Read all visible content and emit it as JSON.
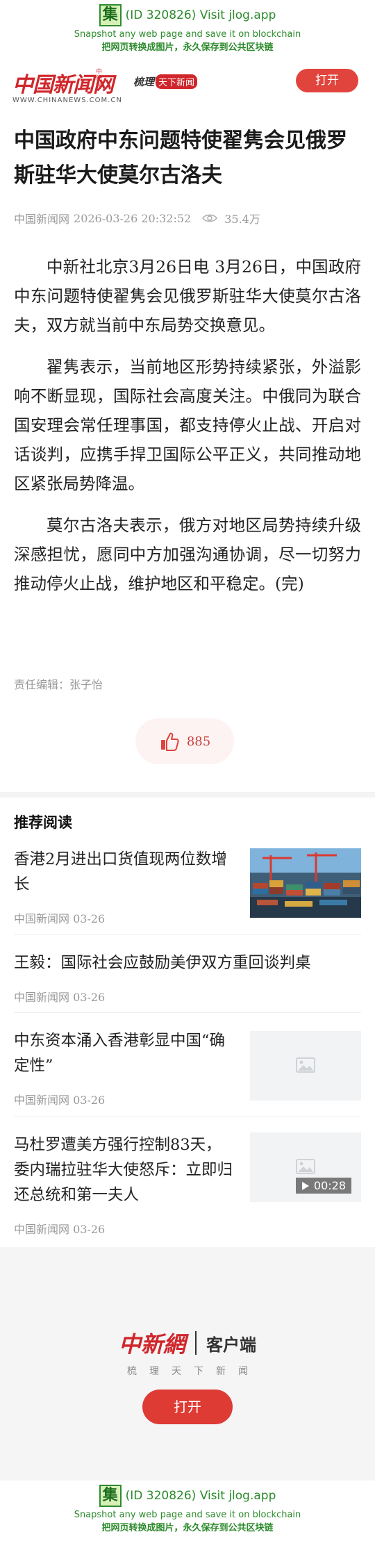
{
  "jlog": {
    "logo_char": "集",
    "visit_text": "(ID 320826) Visit jlog.app",
    "line1": "Snapshot any web page and save it on blockchain",
    "line2": "把网页转换成图片，永久保存到公共区块链"
  },
  "header": {
    "logo_text": "中国新闻网",
    "logo_vertical": "中新网",
    "logo_url": "WWW.CHINANEWS.COM.CN",
    "slogan_pre": "梳理",
    "slogan_seal": "天下新闻",
    "open_label": "打开"
  },
  "article": {
    "title": "中国政府中东问题特使翟隽会见俄罗斯驻华大使莫尔古洛夫",
    "source": "中国新闻网",
    "time": "2026-03-26 20:32:52",
    "views": "35.4万",
    "paragraphs": [
      "中新社北京3月26日电 3月26日，中国政府中东问题特使翟隽会见俄罗斯驻华大使莫尔古洛夫，双方就当前中东局势交换意见。",
      "翟隽表示，当前地区形势持续紧张，外溢影响不断显现，国际社会高度关注。中俄同为联合国安理会常任理事国，都支持停火止战、开启对话谈判，应携手捍卫国际公平正义，共同推动地区紧张局势降温。",
      "莫尔古洛夫表示，俄方对地区局势持续升级深感担忧，愿同中方加强沟通协调，尽一切努力推动停火止战，维护地区和平稳定。(完)"
    ],
    "editor": "责任编辑：张子怡",
    "likes": "885"
  },
  "recommend": {
    "heading": "推荐阅读",
    "items": [
      {
        "title": "香港2月进出口货值现两位数增长",
        "meta": "中国新闻网 03-26"
      },
      {
        "title": "王毅：国际社会应鼓励美伊双方重回谈判桌",
        "meta": "中国新闻网 03-26"
      },
      {
        "title": "中东资本涌入香港彰显中国“确定性”",
        "meta": "中国新闻网 03-26"
      },
      {
        "title": "马杜罗遭美方强行控制83天，委内瑞拉驻华大使怒斥：立即归还总统和第一夫人",
        "meta": "中国新闻网 03-26",
        "video_duration": "00:28"
      }
    ]
  },
  "app_promo": {
    "logo_text": "中新網",
    "client_label": "客户端",
    "slogan": "梳理天下新闻",
    "open_label": "打开"
  },
  "colors": {
    "brand_red": "#d0262b",
    "button_red": "#e1443d",
    "jlog_green": "#2b8a2b"
  }
}
